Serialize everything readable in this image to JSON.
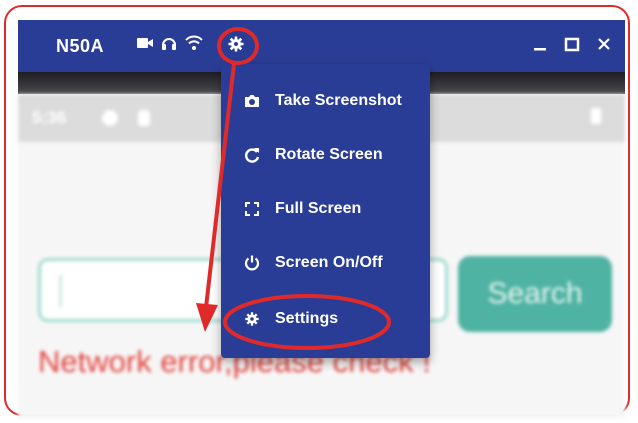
{
  "window": {
    "title": "N50A",
    "status_icons": [
      "video-camera-icon",
      "headphones-icon",
      "wifi-icon"
    ],
    "settings_icon": "gear-icon",
    "controls": [
      "minimize-icon",
      "maximize-icon",
      "close-icon"
    ]
  },
  "menu": {
    "items": [
      {
        "label": "Take Screenshot",
        "icon": "camera-icon"
      },
      {
        "label": "Rotate Screen",
        "icon": "rotate-icon"
      },
      {
        "label": "Full Screen",
        "icon": "fullscreen-icon"
      },
      {
        "label": "Screen On/Off",
        "icon": "power-icon"
      },
      {
        "label": "Settings",
        "icon": "gear-icon"
      }
    ]
  },
  "device_screen": {
    "time": "5:36",
    "search": {
      "placeholder": "",
      "button_label": "Search"
    },
    "error_message": "Network error,please check !"
  },
  "colors": {
    "titlebar": "#2a3d96",
    "accent_teal": "#4fb3a3",
    "annotation_red": "#e02a2a",
    "error_red": "#e2453f"
  }
}
